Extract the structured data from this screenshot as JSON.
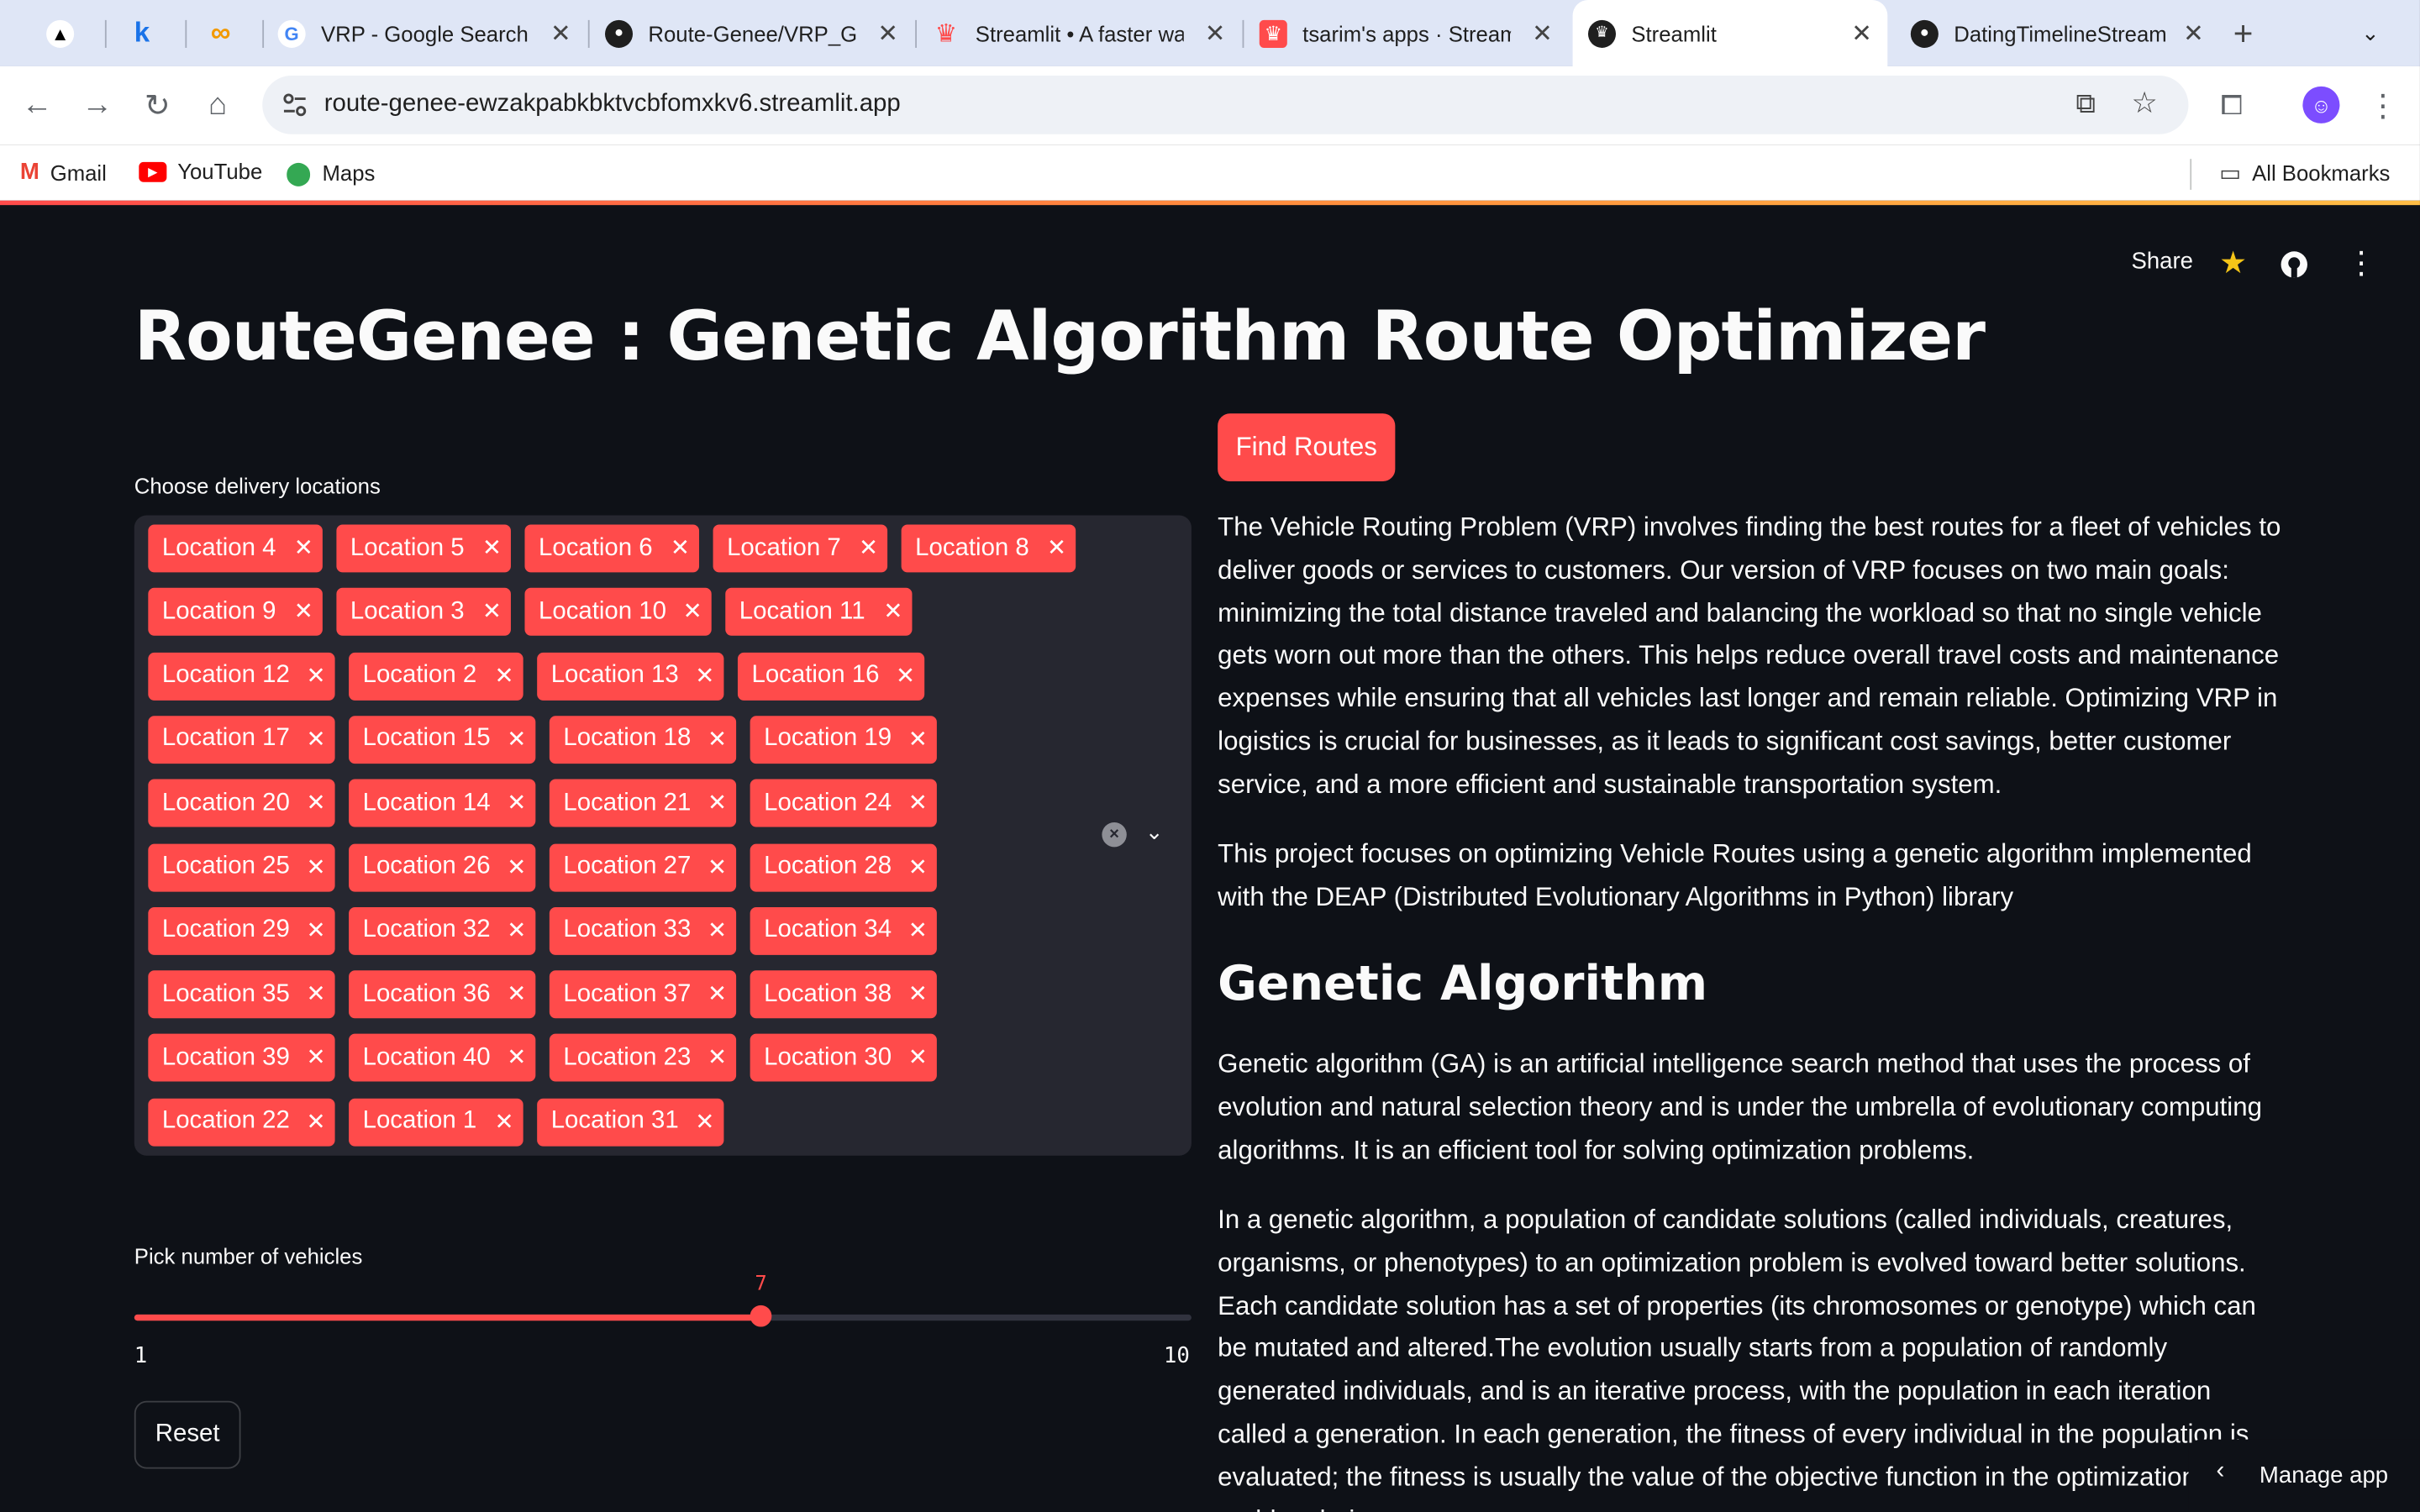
{
  "browser": {
    "tabs": [
      {
        "title": "",
        "icon": "artifact-icon",
        "active": false
      },
      {
        "title": "",
        "icon": "k-icon",
        "active": false
      },
      {
        "title": "",
        "icon": "infinity-icon",
        "active": false
      },
      {
        "title": "VRP - Google Search",
        "icon": "google-icon",
        "active": false
      },
      {
        "title": "Route-Genee/VRP_GA",
        "icon": "github-icon",
        "active": false
      },
      {
        "title": "Streamlit • A faster way",
        "icon": "streamlit-crown-icon",
        "active": false
      },
      {
        "title": "tsarim's apps · Streamlit",
        "icon": "streamlit-crown-icon",
        "active": false
      },
      {
        "title": "Streamlit",
        "icon": "streamlit-icon",
        "active": true
      },
      {
        "title": "DatingTimelineStream",
        "icon": "github-icon",
        "active": false
      }
    ],
    "url": "route-genee-ewzakpabkbktvcbfomxkv6.streamlit.app",
    "bookmarks": [
      "Gmail",
      "YouTube",
      "Maps"
    ],
    "all_bookmarks": "All Bookmarks"
  },
  "app": {
    "header": {
      "share": "Share"
    },
    "title": "RouteGenee : Genetic Algorithm Route Optimizer",
    "locations_label": "Choose delivery locations",
    "selected_locations": [
      [
        "Location 4",
        "Location 5",
        "Location 6",
        "Location 7",
        "Location 8"
      ],
      [
        "Location 9",
        "Location 3",
        "Location 10",
        "Location 11"
      ],
      [
        "Location 12",
        "Location 2",
        "Location 13",
        "Location 16"
      ],
      [
        "Location 17",
        "Location 15",
        "Location 18",
        "Location 19"
      ],
      [
        "Location 20",
        "Location 14",
        "Location 21",
        "Location 24"
      ],
      [
        "Location 25",
        "Location 26",
        "Location 27",
        "Location 28"
      ],
      [
        "Location 29",
        "Location 32",
        "Location 33",
        "Location 34"
      ],
      [
        "Location 35",
        "Location 36",
        "Location 37",
        "Location 38"
      ],
      [
        "Location 39",
        "Location 40",
        "Location 23",
        "Location 30"
      ],
      [
        "Location 22",
        "Location 1",
        "Location 31"
      ]
    ],
    "vehicles_label": "Pick number of vehicles",
    "vehicles": {
      "value": 7,
      "min": 1,
      "max": 10,
      "value_label": "7",
      "min_label": "1",
      "max_label": "10"
    },
    "reset_label": "Reset",
    "find_routes_label": "Find Routes",
    "para1": "The Vehicle Routing Problem (VRP) involves finding the best routes for a fleet of vehicles to deliver goods or services to customers. Our version of VRP focuses on two main goals: minimizing the total distance traveled and balancing the workload so that no single vehicle gets worn out more than the others. This helps reduce overall travel costs and maintenance expenses while ensuring that all vehicles last longer and remain reliable. Optimizing VRP in logistics is crucial for businesses, as it leads to significant cost savings, better customer service, and a more efficient and sustainable transportation system.",
    "para2": "This project focuses on optimizing Vehicle Routes using a genetic algorithm implemented with the DEAP (Distributed Evolutionary Algorithms in Python) library",
    "ga_heading": "Genetic Algorithm",
    "para3": "Genetic algorithm (GA) is an artificial intelligence search method that uses the process of evolution and natural selection theory and is under the umbrella of evolutionary computing algorithms. It is an efficient tool for solving optimization problems.",
    "para4": "In a genetic algorithm, a population of candidate solutions (called individuals, creatures, organisms, or phenotypes) to an optimization problem is evolved toward better solutions. Each candidate solution has a set of properties (its chromosomes or genotype) which can be mutated and altered.The evolution usually starts from a population of randomly generated individuals, and is an iterative process, with the population in each iteration called a generation. In each generation, the fitness of every individual in the population is evaluated; the fitness is usually the value of the objective function in the optimization problem being",
    "manage_app": "Manage app"
  },
  "colors": {
    "accent": "#ff4b4b",
    "background": "#0e1117",
    "widget_bg": "#262730"
  }
}
